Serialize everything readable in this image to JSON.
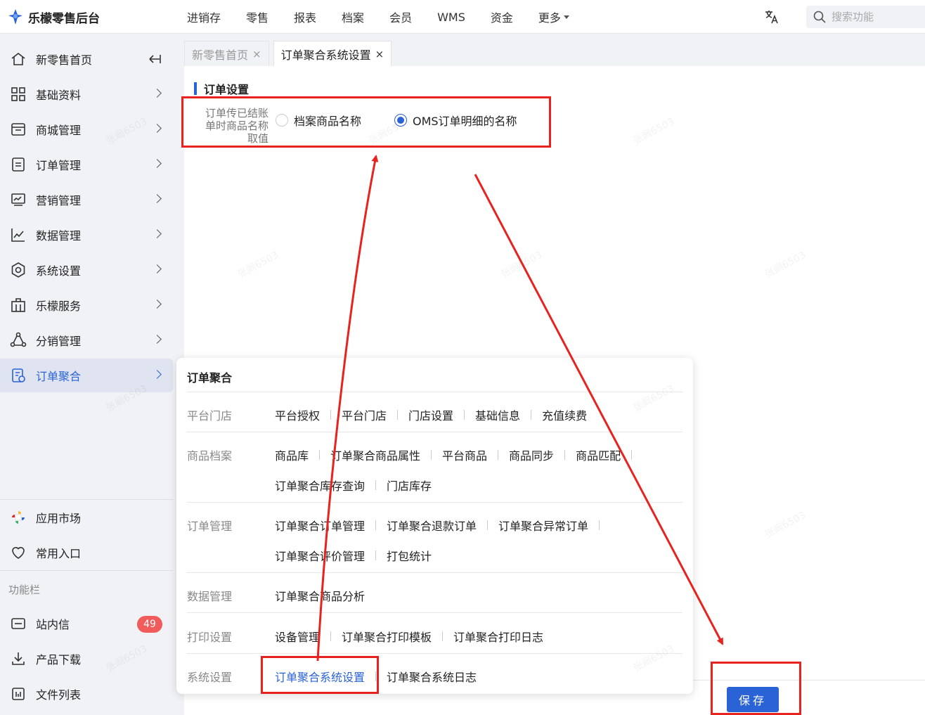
{
  "app": {
    "title": "乐檬零售后台"
  },
  "topnav": [
    {
      "label": "进销存"
    },
    {
      "label": "零售"
    },
    {
      "label": "报表"
    },
    {
      "label": "档案"
    },
    {
      "label": "会员"
    },
    {
      "label": "WMS"
    },
    {
      "label": "资金"
    },
    {
      "label": "更多"
    }
  ],
  "search": {
    "placeholder": "搜索功能"
  },
  "sidebar": {
    "home": "新零售首页",
    "items": [
      {
        "label": "基础资料"
      },
      {
        "label": "商城管理"
      },
      {
        "label": "订单管理"
      },
      {
        "label": "营销管理"
      },
      {
        "label": "数据管理"
      },
      {
        "label": "系统设置"
      },
      {
        "label": "乐檬服务"
      },
      {
        "label": "分销管理"
      },
      {
        "label": "订单聚合"
      }
    ],
    "app_market": "应用市场",
    "favorites": "常用入口",
    "section": "功能栏",
    "messages": "站内信",
    "messages_badge": "49",
    "downloads": "产品下载",
    "files": "文件列表"
  },
  "tabs": [
    {
      "label": "新零售首页",
      "close": "×"
    },
    {
      "label": "订单聚合系统设置",
      "close": "×"
    }
  ],
  "form": {
    "section_title": "订单设置",
    "label_lines": [
      "订单传已结账",
      "单时商品名称",
      "取值"
    ],
    "options": [
      {
        "label": "档案商品名称",
        "checked": false
      },
      {
        "label": "OMS订单明细的名称",
        "checked": true
      }
    ],
    "save_label": "保存"
  },
  "flyout": {
    "title": "订单聚合",
    "groups": [
      {
        "category": "平台门店",
        "rows": [
          [
            "平台授权",
            "平台门店",
            "门店设置",
            "基础信息",
            "充值续费"
          ]
        ]
      },
      {
        "category": "商品档案",
        "rows": [
          [
            "商品库",
            "订单聚合商品属性",
            "平台商品",
            "商品同步",
            "商品匹配"
          ],
          [
            "订单聚合库存查询",
            "门店库存"
          ]
        ]
      },
      {
        "category": "订单管理",
        "rows": [
          [
            "订单聚合订单管理",
            "订单聚合退款订单",
            "订单聚合异常订单"
          ],
          [
            "订单聚合评价管理",
            "打包统计"
          ]
        ]
      },
      {
        "category": "数据管理",
        "rows": [
          [
            "订单聚合商品分析"
          ]
        ]
      },
      {
        "category": "打印设置",
        "rows": [
          [
            "设备管理",
            "订单聚合打印模板",
            "订单聚合打印日志"
          ]
        ]
      },
      {
        "category": "系统设置",
        "rows": [
          [
            "订单聚合系统设置",
            "订单聚合系统日志"
          ]
        ]
      }
    ],
    "active_link": "订单聚合系统设置"
  },
  "colors": {
    "accent": "#2a63d6",
    "annotation": "#e8231f",
    "badge": "#f25b5b"
  },
  "watermark": "张阚6503"
}
